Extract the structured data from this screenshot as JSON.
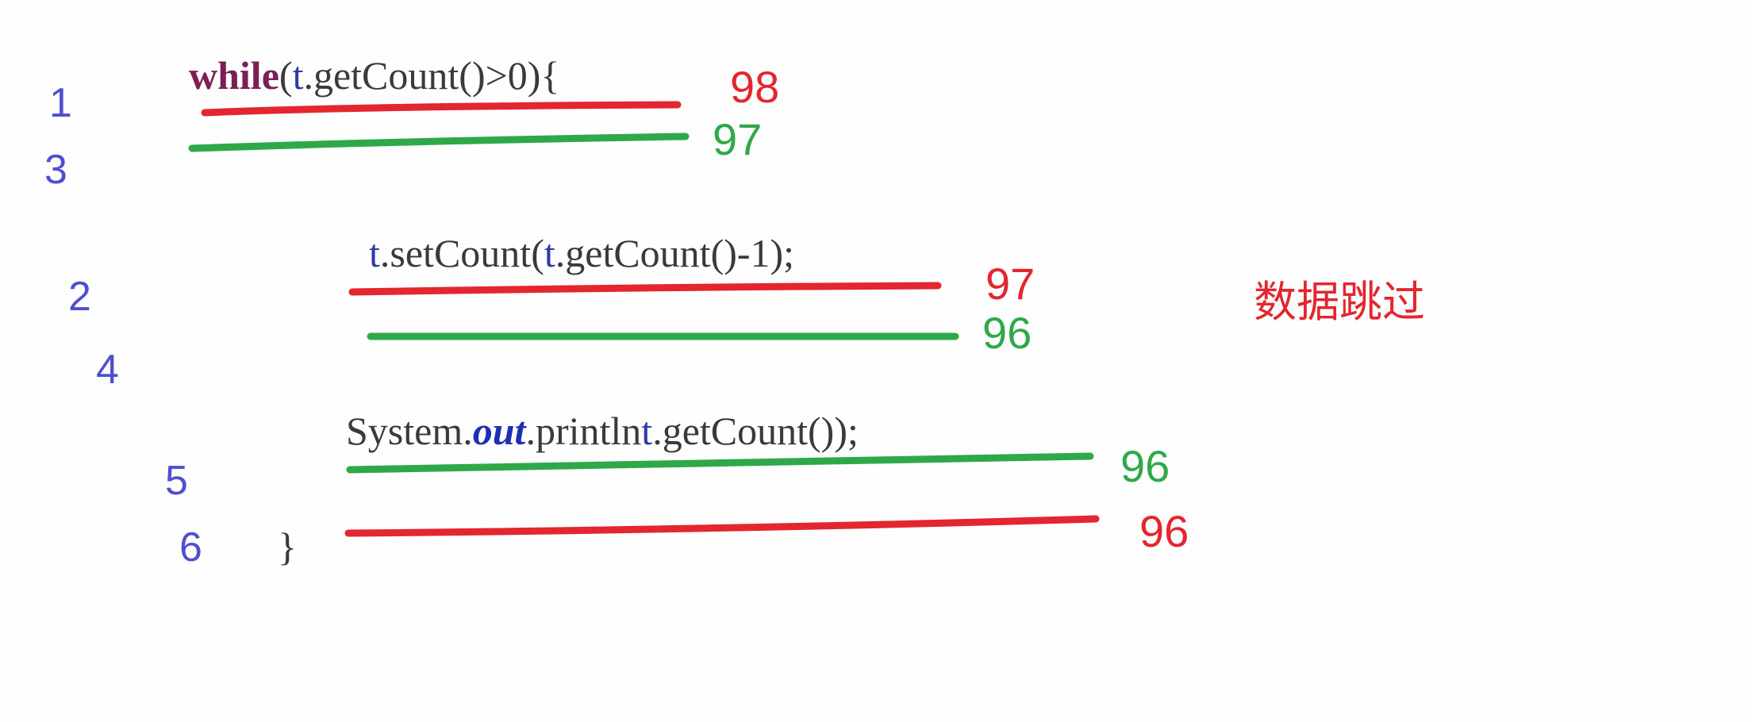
{
  "code": {
    "line1": {
      "keyword": "while",
      "open": "(",
      "var": "t",
      "rest": ".getCount()>0){"
    },
    "line2": {
      "var1": "t",
      "mid": ".setCount(",
      "var2": "t",
      "rest": ".getCount()-1);"
    },
    "line3": {
      "pre": "System.",
      "field": "out",
      "mid": ".println",
      "var": "t",
      "rest": ".getCount());"
    },
    "line4": "}"
  },
  "sequence_numbers": [
    "1",
    "3",
    "2",
    "4",
    "5",
    "6"
  ],
  "thread_values": {
    "red": [
      "98",
      "97",
      "96"
    ],
    "green": [
      "97",
      "96",
      "96"
    ]
  },
  "note": "数据跳过",
  "colors": {
    "red": "#e3262f",
    "green": "#2fa84a",
    "sequence": "#4f4fd0"
  }
}
